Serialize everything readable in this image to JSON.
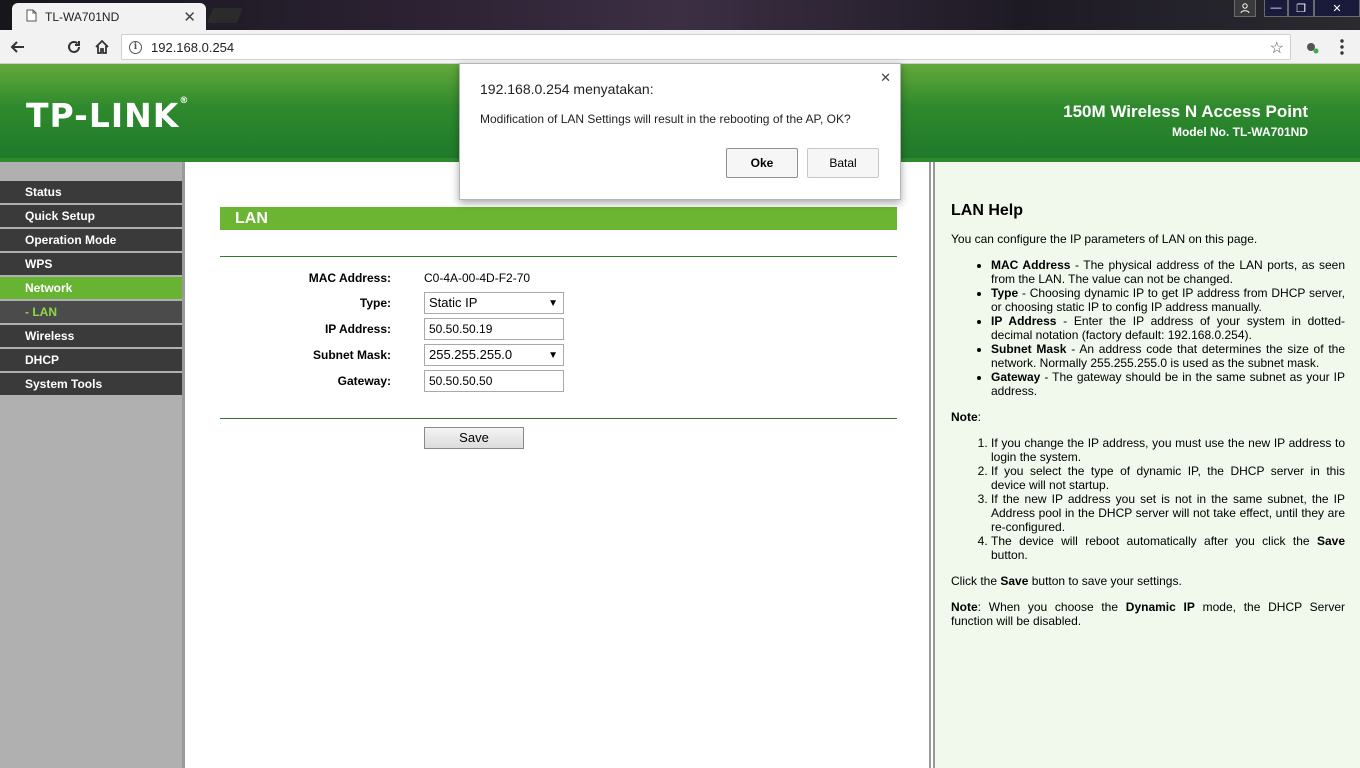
{
  "browser": {
    "tab_title": "TL-WA701ND",
    "url": "192.168.0.254"
  },
  "banner": {
    "logo": "TP-LINK",
    "logo_mark": "®",
    "product": "150M Wireless N Access Point",
    "model": "Model No. TL-WA701ND"
  },
  "sidebar": {
    "items": [
      {
        "label": "Status"
      },
      {
        "label": "Quick Setup"
      },
      {
        "label": "Operation Mode"
      },
      {
        "label": "WPS"
      },
      {
        "label": "Network"
      },
      {
        "label": "- LAN"
      },
      {
        "label": "Wireless"
      },
      {
        "label": "DHCP"
      },
      {
        "label": "System Tools"
      }
    ]
  },
  "main": {
    "header": "LAN",
    "mac_label": "MAC Address:",
    "mac_value": "C0-4A-00-4D-F2-70",
    "type_label": "Type:",
    "type_value": "Static IP",
    "ip_label": "IP Address:",
    "ip_value": "50.50.50.19",
    "mask_label": "Subnet Mask:",
    "mask_value": "255.255.255.0",
    "gateway_label": "Gateway:",
    "gateway_value": "50.50.50.50",
    "save_label": "Save"
  },
  "help": {
    "title": "LAN Help",
    "intro": "You can configure the IP parameters of LAN on this page.",
    "bullets": [
      {
        "term": "MAC Address",
        "text": " - The physical address of the LAN ports, as seen from the LAN. The value can not be changed."
      },
      {
        "term": "Type",
        "text": " - Choosing dynamic IP to get IP address from DHCP server, or choosing static IP to config IP address manually."
      },
      {
        "term": "IP Address",
        "text": " - Enter the IP address of your system in dotted-decimal notation (factory default: 192.168.0.254)."
      },
      {
        "term": "Subnet Mask",
        "text": " - An address code that determines the size of the network. Normally 255.255.255.0 is used as the subnet mask."
      },
      {
        "term": "Gateway",
        "text": " - The gateway should be in the same subnet as your IP address."
      }
    ],
    "note_label": "Note",
    "note_colon": ":",
    "notes": [
      "If you change the IP address, you must use the new IP address to login the system.",
      "If you select the type of dynamic IP, the DHCP server in this device will not startup.",
      "If the new IP address you set is not in the same subnet, the IP Address pool in the DHCP server will not take effect, until they are re-configured."
    ],
    "note4_pre": "The device will reboot automatically after you click the ",
    "note4_bold": "Save",
    "note4_post": " button.",
    "click_pre": "Click the ",
    "click_bold": "Save",
    "click_post": " button to save your settings.",
    "note2_label": "Note",
    "note2_pre": ": When you choose the ",
    "note2_bold": "Dynamic IP",
    "note2_post": " mode, the DHCP Server function will be disabled."
  },
  "dialog": {
    "title": "192.168.0.254 menyatakan:",
    "message": "Modification of LAN Settings will result in the rebooting of the AP, OK?",
    "ok_label": "Oke",
    "cancel_label": "Batal"
  }
}
